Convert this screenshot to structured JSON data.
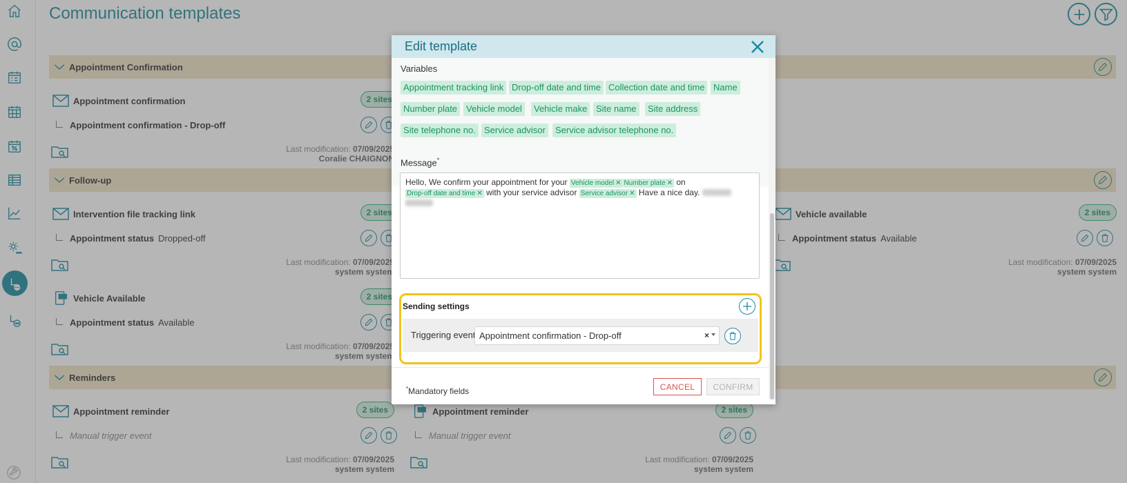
{
  "page": {
    "title": "Communication templates"
  },
  "sections": [
    {
      "label": "Appointment Confirmation",
      "cards": [
        {
          "title": "Appointment confirmation",
          "sites": "2 sites",
          "sub_bold": "Appointment confirmation - Drop-off",
          "sub_value": "",
          "mod_label": "Last modification:",
          "mod_date": "07/09/2025",
          "mod_user": "Coralie CHAIGNON"
        }
      ]
    },
    {
      "label": "Follow-up",
      "cards": [
        {
          "title": "Intervention file tracking link",
          "sites": "2 sites",
          "sub_bold": "Appointment status",
          "sub_value": "Dropped-off",
          "mod_label": "Last modification:",
          "mod_date": "07/09/2025",
          "mod_user": "system system"
        },
        {
          "title": "Vehicle available",
          "sites": "2 sites",
          "sub_bold": "Appointment status",
          "sub_value": "Available",
          "mod_label": "Last modification:",
          "mod_date": "07/09/2025",
          "mod_user": "system system"
        },
        {
          "title": "Vehicle Available",
          "sites": "2 sites",
          "sub_bold": "Appointment status",
          "sub_value": "Available",
          "mod_label": "Last modification:",
          "mod_date": "07/09/2025",
          "mod_user": "system system"
        }
      ]
    },
    {
      "label": "Reminders",
      "cards": [
        {
          "title": "Appointment reminder",
          "sites": "2 sites",
          "sub_italic": "Manual trigger event",
          "mod_label": "Last modification:",
          "mod_date": "07/09/2025",
          "mod_user": "system system"
        },
        {
          "title": "Appointment reminder",
          "sites": "2 sites",
          "sub_italic": "Manual trigger event",
          "mod_label": "Last modification:",
          "mod_date": "07/09/2025",
          "mod_user": "system system"
        }
      ]
    }
  ],
  "modal": {
    "title": "Edit template",
    "variables_label": "Variables",
    "variables": [
      "Appointment tracking link",
      "Drop-off date and time",
      "Collection date and time",
      "Name",
      "Number plate",
      "Vehicle model",
      "Vehicle make",
      "Site name",
      "Site address",
      "Site telephone no.",
      "Service advisor",
      "Service advisor telephone no."
    ],
    "message_label": "Message",
    "message_required_mark": "*",
    "message": {
      "t1": "Hello, We confirm your appointment for your",
      "c1": "Vehicle model",
      "c2": "Number plate",
      "t2": "on",
      "c3": "Drop-off date and time",
      "t3": "with your service advisor",
      "c4": "Service advisor",
      "t4": "Have a nice day."
    },
    "sending_settings": {
      "title": "Sending settings",
      "triggering_label": "Triggering event",
      "triggering_value": "Appointment confirmation - Drop-off",
      "clear": "×"
    },
    "footer": {
      "mandatory_mark": "*",
      "mandatory_text": "Mandatory fields",
      "cancel": "CANCEL",
      "confirm": "CONFIRM"
    }
  },
  "colors": {
    "accent": "#1a8aa1",
    "section_bar": "#efe3c6",
    "chip_bg": "#cdeedd",
    "chip_text": "#1d9362",
    "highlight": "#f2c41b",
    "cancel": "#d9534f"
  },
  "icons": {
    "sidebar": [
      "home-icon",
      "at-icon",
      "calendar-list-icon",
      "calendar-grid-icon",
      "calendar-percent-icon",
      "table-icon",
      "chart-line-icon",
      "settings-chat-icon",
      "workflow-chat-icon-active",
      "workflow-chat-icon",
      "wrench-icon"
    ]
  }
}
